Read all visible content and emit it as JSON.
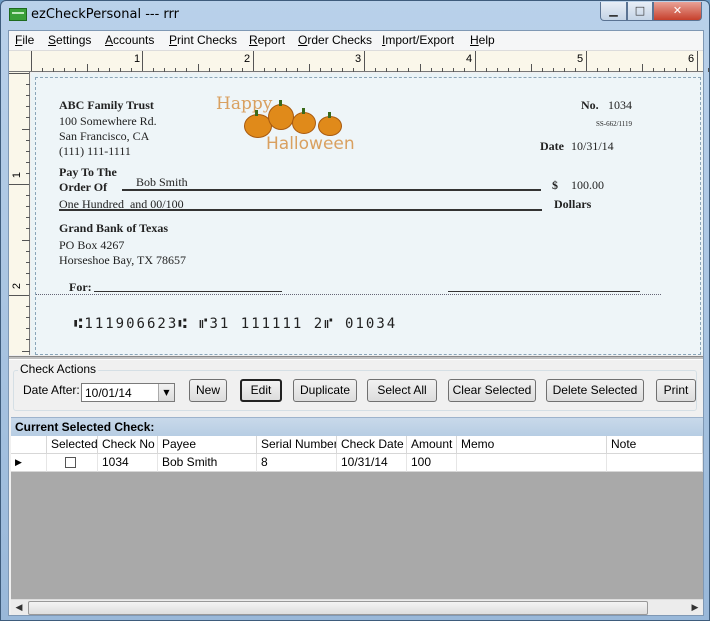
{
  "window": {
    "title": "ezCheckPersonal --- rrr",
    "minimize": "▁",
    "maximize": "□",
    "close": "✕"
  },
  "menu": [
    "File",
    "Settings",
    "Accounts",
    "Print Checks",
    "Report",
    "Order Checks",
    "Import/Export",
    "Help"
  ],
  "ruler": {
    "top_numbers": [
      "1",
      "2",
      "3",
      "4",
      "5",
      "6"
    ],
    "left_numbers": [
      "1",
      "2"
    ]
  },
  "check": {
    "payer_name": "ABC Family Trust",
    "payer_address1": "100 Somewhere Rd.",
    "payer_address2": "San Francisco, CA",
    "payer_phone": "(111) 111-1111",
    "logo_word1": "Happy",
    "logo_word2": "Halloween",
    "no_label": "No.",
    "check_no": "1034",
    "fraction": "SS-662/1119",
    "date_label": "Date",
    "date": "10/31/14",
    "pay_to_label1": "Pay To The",
    "pay_to_label2": "Order Of",
    "payee": "Bob Smith",
    "dollar_sign": "$",
    "amount": "100.00",
    "amount_words": "One Hundred  and 00/100",
    "dollars_label": "Dollars",
    "bank_name": "Grand Bank of Texas",
    "bank_address1": "PO Box 4267",
    "bank_address2": "Horseshoe Bay, TX 78657",
    "for_label": "For:",
    "micr": "⑆111906623⑆  ⑈31 111111 2⑈  01034"
  },
  "actions": {
    "group_title": "Check Actions",
    "date_after_label": "Date After:",
    "date_after_value": "10/01/14",
    "buttons": [
      "New",
      "Edit",
      "Duplicate",
      "Select All",
      "Clear Selected",
      "Delete Selected",
      "Print"
    ]
  },
  "grid": {
    "title": "Current Selected Check:",
    "columns": [
      "Selected",
      "Check No",
      "Payee",
      "Serial Number",
      "Check Date",
      "Amount",
      "Memo",
      "Note"
    ],
    "rows": [
      {
        "selected": false,
        "check_no": "1034",
        "payee": "Bob Smith",
        "serial": "8",
        "check_date": "10/31/14",
        "amount": "100",
        "memo": "",
        "note": ""
      }
    ],
    "row_indicator": "▶"
  }
}
